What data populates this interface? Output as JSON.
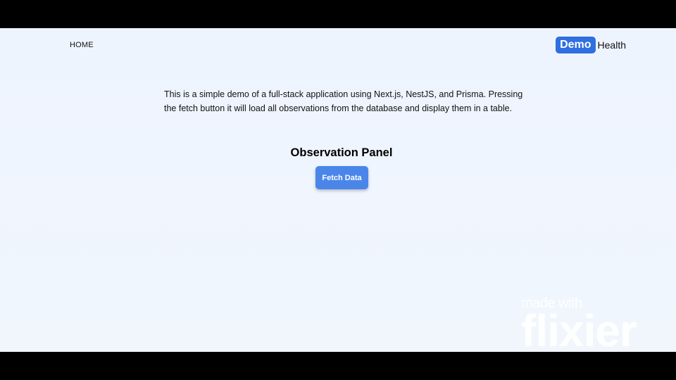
{
  "nav": {
    "home_label": "HOME"
  },
  "brand": {
    "badge": "Demo",
    "text": "Health",
    "accent_color": "#2f6fe0"
  },
  "main": {
    "intro": "This is a simple demo of a full-stack application using Next.js, NestJS, and Prisma. Pressing the fetch button it will load all observations from the database and display them in a table.",
    "panel_title": "Observation Panel",
    "fetch_button_label": "Fetch Data",
    "button_color": "#4a86ea"
  },
  "watermark": {
    "top": "made with",
    "main": "flixier"
  }
}
